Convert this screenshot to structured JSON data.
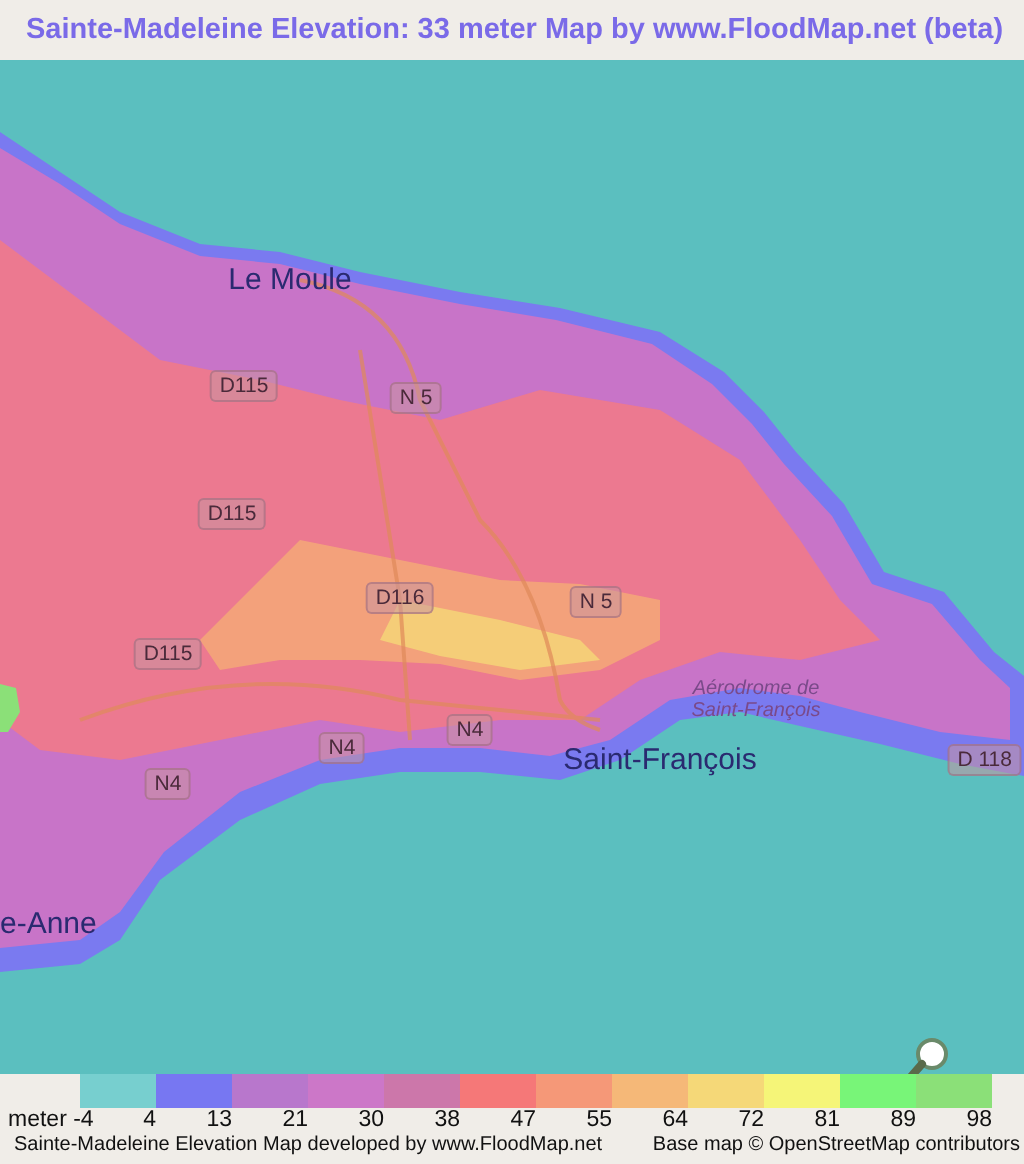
{
  "title": "Sainte-Madeleine Elevation: 33 meter Map by www.FloodMap.net (beta)",
  "map": {
    "labels": [
      {
        "kind": "place",
        "text": "Le Moule"
      },
      {
        "kind": "road",
        "text": "D115"
      },
      {
        "kind": "road",
        "text": "N 5"
      },
      {
        "kind": "road",
        "text": "D115"
      },
      {
        "kind": "road",
        "text": "D116"
      },
      {
        "kind": "road",
        "text": "N 5"
      },
      {
        "kind": "road",
        "text": "D115"
      },
      {
        "kind": "poi",
        "text": "Aérodrome de Saint-François"
      },
      {
        "kind": "road",
        "text": "N4"
      },
      {
        "kind": "road",
        "text": "N4"
      },
      {
        "kind": "road",
        "text": "N4"
      },
      {
        "kind": "place",
        "text": "Saint-François"
      },
      {
        "kind": "road",
        "text": "D 118"
      },
      {
        "kind": "place",
        "text": "e-Anne"
      }
    ]
  },
  "legend": {
    "swatches": [
      {
        "color": "#77cfcf"
      },
      {
        "color": "#7777f2"
      },
      {
        "color": "#b877cc"
      },
      {
        "color": "#cc77c8"
      },
      {
        "color": "#cc77aa"
      },
      {
        "color": "#f57878"
      },
      {
        "color": "#f59878"
      },
      {
        "color": "#f5b878"
      },
      {
        "color": "#f5d878"
      },
      {
        "color": "#f5f578"
      },
      {
        "color": "#78f578"
      },
      {
        "color": "#8be078"
      }
    ],
    "ticks": [
      "meter -4",
      "4",
      "13",
      "21",
      "30",
      "38",
      "47",
      "55",
      "64",
      "72",
      "81",
      "89",
      "98"
    ]
  },
  "footer": {
    "left": "Sainte-Madeleine Elevation Map developed by www.FloodMap.net",
    "right": "Base map © OpenStreetMap contributors"
  }
}
